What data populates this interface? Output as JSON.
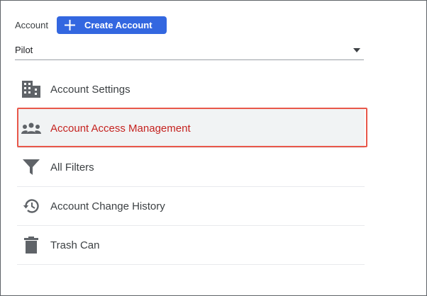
{
  "header": {
    "account_label": "Account",
    "create_button_label": "Create Account",
    "create_button_icon": "plus-icon"
  },
  "account_select": {
    "value": "Pilot",
    "caret_icon": "caret-down-icon"
  },
  "menu": {
    "items": [
      {
        "label": "Account Settings",
        "icon": "building-icon",
        "active": false
      },
      {
        "label": "Account Access Management",
        "icon": "people-icon",
        "active": true
      },
      {
        "label": "All Filters",
        "icon": "filter-icon",
        "active": false
      },
      {
        "label": "Account Change History",
        "icon": "history-icon",
        "active": false
      },
      {
        "label": "Trash Can",
        "icon": "trash-icon",
        "active": false
      }
    ]
  },
  "colors": {
    "accent_blue": "#3367e0",
    "active_text": "#c5221f",
    "highlight_border": "#e8574a",
    "icon_gray": "#5f6368"
  }
}
